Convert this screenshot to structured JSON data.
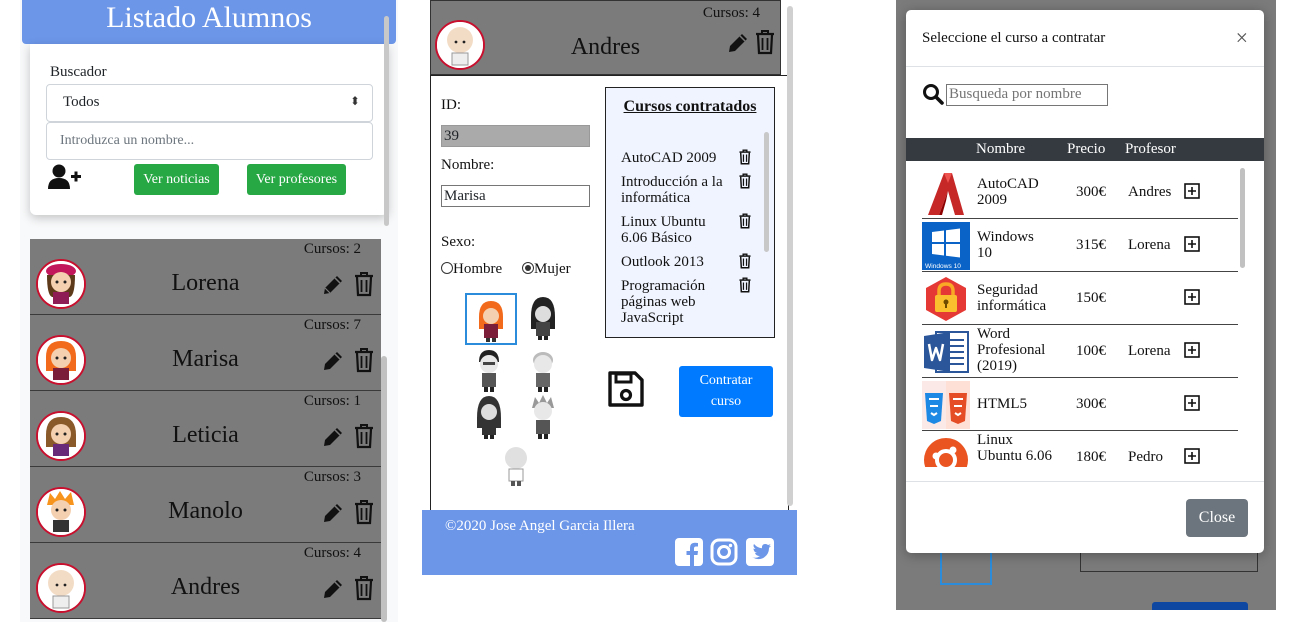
{
  "colors": {
    "header_blue": "#6c96e8",
    "green": "#28a745",
    "blue": "#007bff",
    "card_gray": "#7b7b7b",
    "dark": "#343a40"
  },
  "list_panel": {
    "title": "Listado Alumnos",
    "search_label": "Buscador",
    "filter_selected": "Todos",
    "name_placeholder": "Introduzca un nombre...",
    "add_icon": "user-plus-icon",
    "btn_news": "Ver noticias",
    "btn_teachers": "Ver profesores",
    "students": [
      {
        "name": "Lorena",
        "courses": "Cursos: 2"
      },
      {
        "name": "Marisa",
        "courses": "Cursos: 7"
      },
      {
        "name": "Leticia",
        "courses": "Cursos: 1"
      },
      {
        "name": "Manolo",
        "courses": "Cursos: 3"
      },
      {
        "name": "Andres",
        "courses": "Cursos: 4"
      }
    ]
  },
  "detail_panel": {
    "top_student": {
      "name": "Andres",
      "courses": "Cursos: 4"
    },
    "id_label": "ID:",
    "id_value": "39",
    "name_label": "Nombre:",
    "name_value": "Marisa",
    "sex_label": "Sexo:",
    "sex_male": "Hombre",
    "sex_female": "Mujer",
    "sex_selected": "Mujer",
    "contracted_title": "Cursos contratados",
    "contracted": [
      "AutoCAD 2009",
      "Introducción a la informática",
      "Linux Ubuntu 6.06 Básico",
      "Outlook 2013",
      "Programación páginas web JavaScript"
    ],
    "btn_contract_line1": "Contratar",
    "btn_contract_line2": "curso",
    "save_icon": "floppy-disk-icon",
    "footer_text": "©2020 Jose Angel Garcia Illera",
    "social_icons": [
      "facebook-icon",
      "instagram-icon",
      "twitter-icon"
    ]
  },
  "modal": {
    "title": "Seleccione el curso a contratar",
    "close_x": "×",
    "search_placeholder": "Busqueda por nombre",
    "col_name": "Nombre",
    "col_price": "Precio",
    "col_teacher": "Profesor",
    "rows": [
      {
        "name_l1": "AutoCAD",
        "name_l2": "2009",
        "name_l3": "",
        "price": "300€",
        "teacher": "Andres",
        "icon": "autocad-icon"
      },
      {
        "name_l1": "Windows",
        "name_l2": "10",
        "name_l3": "",
        "price": "315€",
        "teacher": "Lorena",
        "icon": "windows-icon",
        "icon_caption": "Windows 10"
      },
      {
        "name_l1": "Seguridad",
        "name_l2": "informática",
        "name_l3": "",
        "price": "150€",
        "teacher": "",
        "icon": "lock-icon"
      },
      {
        "name_l1": "Word",
        "name_l2": "Profesional",
        "name_l3": "(2019)",
        "price": "100€",
        "teacher": "Lorena",
        "icon": "word-icon"
      },
      {
        "name_l1": "HTML5",
        "name_l2": "",
        "name_l3": "",
        "price": "300€",
        "teacher": "",
        "icon": "css-html-icon"
      },
      {
        "name_l1": "Linux",
        "name_l2": "Ubuntu 6.06",
        "name_l3": "",
        "price": "180€",
        "teacher": "Pedro",
        "icon": "ubuntu-icon"
      }
    ],
    "btn_close": "Close"
  }
}
